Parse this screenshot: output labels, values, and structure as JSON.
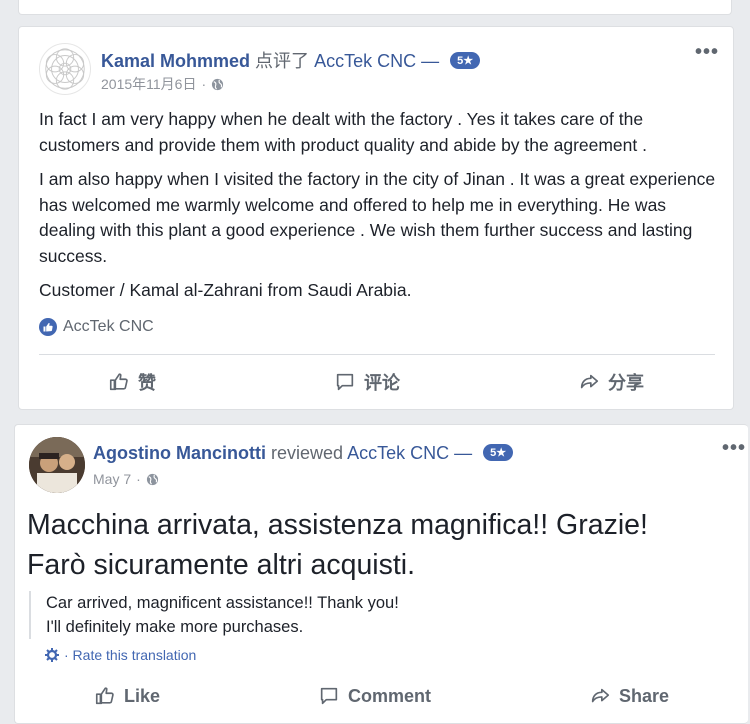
{
  "post1": {
    "author": "Kamal Mohmmed",
    "verb": "点评了",
    "page": "AccTek CNC —",
    "rating_badge": "5★",
    "date": "2015年11月6日",
    "separator": "·",
    "more": "•••",
    "paragraphs": [
      "In fact I am very happy when he dealt with the factory . Yes it takes care of the customers and provide them with product quality and abide by the agreement .",
      "I am also happy when I visited the factory in the city of Jinan . It was a great experience has welcomed me warmly welcome and offered to help me in everything. He was dealing with this plant a good experience . We wish them further success and lasting success.",
      "Customer / Kamal al-Zahrani from Saudi Arabia."
    ],
    "page_like": "AccTek CNC",
    "actions": {
      "like": "赞",
      "comment": "评论",
      "share": "分享"
    }
  },
  "post2": {
    "author": "Agostino Mancinotti",
    "verb": "reviewed",
    "page": "AccTek CNC —",
    "rating_badge": "5★",
    "date": "May 7",
    "separator": "·",
    "more": "•••",
    "original_lines": [
      "Macchina arrivata, assistenza magnifica!! Grazie!",
      "Farò sicuramente altri acquisti."
    ],
    "translation_lines": [
      "Car arrived, magnificent assistance!! Thank you!",
      "I'll definitely make more purchases."
    ],
    "rate_translation": "· Rate this translation",
    "actions": {
      "like": "Like",
      "comment": "Comment",
      "share": "Share"
    }
  },
  "colors": {
    "link": "#385898",
    "accent": "#4267b2",
    "muted": "#90949c"
  }
}
